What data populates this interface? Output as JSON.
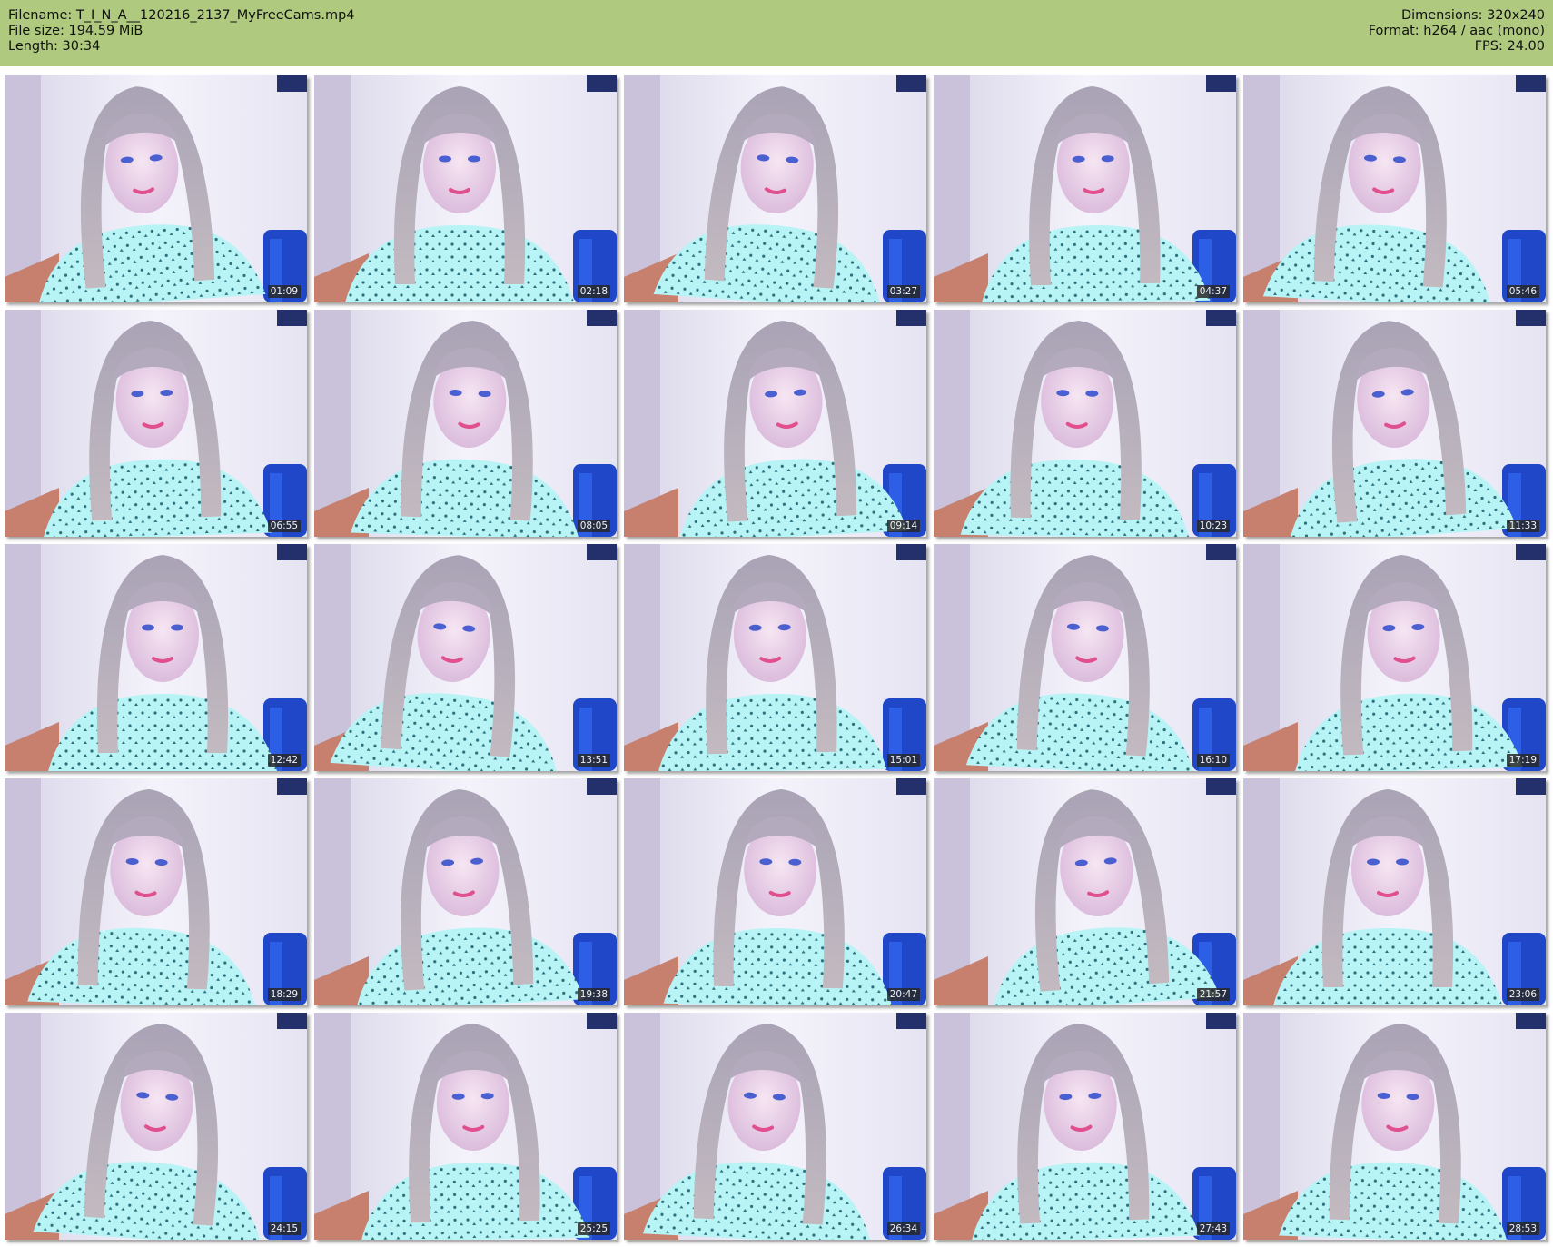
{
  "header": {
    "filename_label": "Filename:",
    "filename": "T_I_N_A__120216_2137_MyFreeCams.mp4",
    "filesize_label": "File size:",
    "filesize": "194.59 MiB",
    "length_label": "Length:",
    "length": "30:34",
    "dimensions_label": "Dimensions:",
    "dimensions": "320x240",
    "format_label": "Format:",
    "format": "h264 / aac (mono)",
    "fps_label": "FPS:",
    "fps": "24.00"
  },
  "colors": {
    "header_bg": "#afc97e",
    "page_bg": "#ffffff",
    "timestamp_bg": "#282828"
  },
  "thumbnails": [
    {
      "timestamp": "01:09"
    },
    {
      "timestamp": "02:18"
    },
    {
      "timestamp": "03:27"
    },
    {
      "timestamp": "04:37"
    },
    {
      "timestamp": "05:46"
    },
    {
      "timestamp": "06:55"
    },
    {
      "timestamp": "08:05"
    },
    {
      "timestamp": "09:14"
    },
    {
      "timestamp": "10:23"
    },
    {
      "timestamp": "11:33"
    },
    {
      "timestamp": "12:42"
    },
    {
      "timestamp": "13:51"
    },
    {
      "timestamp": "15:01"
    },
    {
      "timestamp": "16:10"
    },
    {
      "timestamp": "17:19"
    },
    {
      "timestamp": "18:29"
    },
    {
      "timestamp": "19:38"
    },
    {
      "timestamp": "20:47"
    },
    {
      "timestamp": "21:57"
    },
    {
      "timestamp": "23:06"
    },
    {
      "timestamp": "24:15"
    },
    {
      "timestamp": "25:25"
    },
    {
      "timestamp": "26:34"
    },
    {
      "timestamp": "27:43"
    },
    {
      "timestamp": "28:53"
    }
  ]
}
